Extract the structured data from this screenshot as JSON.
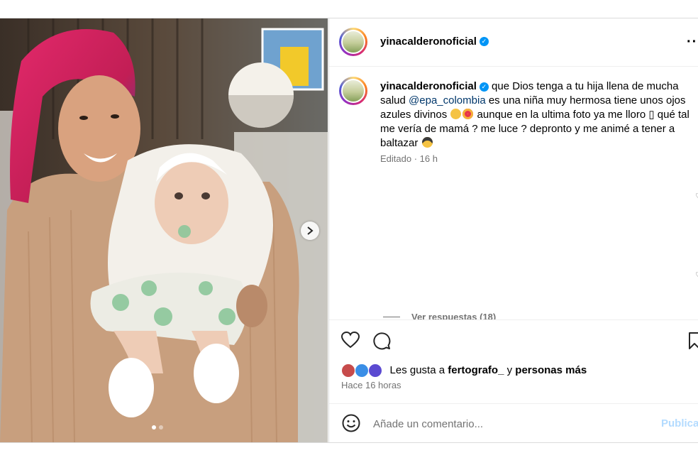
{
  "post": {
    "username": "yinacalderonoficial",
    "more_icon": "more-options-icon",
    "verified_icon": "verified-badge-icon"
  },
  "caption": {
    "username": "yinacalderonoficial",
    "part1": " que Dios tenga a tu hija llena de mucha salud ",
    "mention": "@epa_colombia",
    "part2": " es una niña muy hermosa tiene unos ojos azules divinos ",
    "part3": " aunque en la ultima foto ya me lloro ",
    "unknown_glyph": "▯",
    "part4": " qué tal me vería de mamá ? me luce ? depronto y me animé a tener a baltazar ",
    "edited_label": "Editado",
    "separator": " · ",
    "age": "16 h"
  },
  "replies": {
    "label": "Ver respuestas (18)"
  },
  "actions": {
    "like_icon": "heart-icon",
    "comment_icon": "comment-icon",
    "save_icon": "bookmark-icon"
  },
  "likes": {
    "prefix": "Les gusta a ",
    "user": "fertografo_",
    "middle": " y ",
    "suffix": "personas más"
  },
  "timestamp": "Hace 16 horas",
  "comment_box": {
    "placeholder": "Añade un comentario...",
    "post_label": "Publicar",
    "emoji_icon": "emoji-icon"
  },
  "colors": {
    "link": "#00376b",
    "secondary": "#737373",
    "verified": "#0095f6",
    "post_disabled": "#b3dbff"
  }
}
